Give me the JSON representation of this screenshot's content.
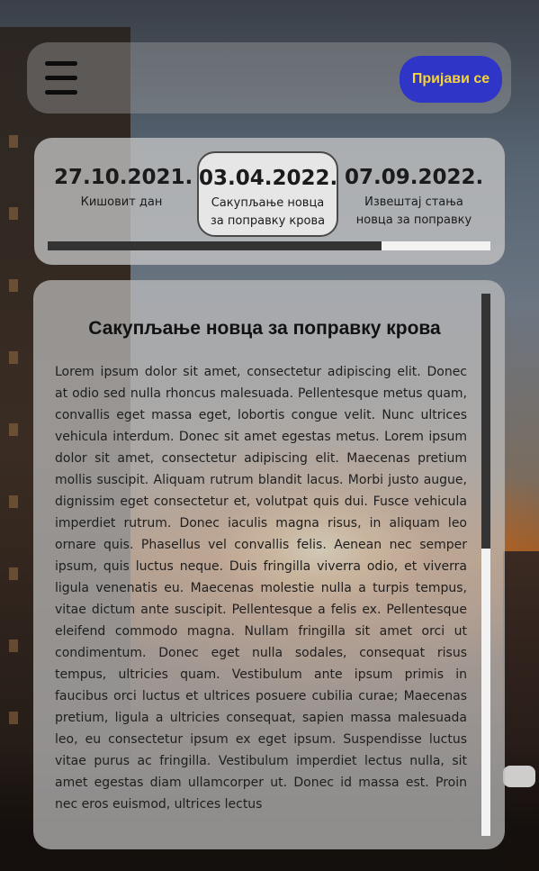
{
  "header": {
    "menu_icon": "hamburger-menu-icon",
    "login_label": "Пријави се"
  },
  "timeline": {
    "items": [
      {
        "date": "27.10.2021.",
        "label_line1": "Кишовит дан",
        "label_line2": ""
      },
      {
        "date": "03.04.2022.",
        "label_line1": "Сакупљање новца",
        "label_line2": "за поправку крова"
      },
      {
        "date": "07.09.2022.",
        "label_line1": "Извештај стања",
        "label_line2": "новца за поправку"
      }
    ],
    "active_index": 1,
    "progress": 0.755
  },
  "article": {
    "title": "Сакупљање новца за поправку крова",
    "body": "Lorem ipsum dolor sit amet, consectetur adipiscing elit. Donec at odio sed nulla rhoncus malesuada. Pellentesque metus quam, convallis eget massa eget, lobortis congue velit. Nunc ultrices vehicula interdum. Donec sit amet egestas metus. Lorem ipsum dolor sit amet, consectetur adipiscing elit. Maecenas pretium mollis suscipit. Aliquam rutrum blandit lacus. Morbi justo augue, dignissim eget consectetur et, volutpat quis dui. Fusce vehicula imperdiet rutrum. Donec iaculis magna risus, in aliquam leo ornare quis. Phasellus vel convallis felis. Aenean nec semper ipsum, quis luctus neque. Duis fringilla viverra odio, et viverra ligula venenatis eu. Maecenas molestie nulla a turpis tempus, vitae dictum ante suscipit. Pellentesque a felis ex. Pellentesque eleifend commodo magna. Nullam fringilla sit amet orci ut condimentum. Donec eget nulla sodales, consequat risus tempus, ultricies quam. Vestibulum ante ipsum primis in faucibus orci luctus et ultrices posuere cubilia curae; Maecenas pretium, ligula a ultricies consequat, sapien massa malesuada leo, eu consectetur ipsum ex eget ipsum. Suspendisse luctus vitae purus ac fringilla. Vestibulum imperdiet lectus nulla, sit amet egestas diam ullamcorper ut. Donec id massa est. Proin nec eros euismod, ultrices lectus",
    "scroll_fraction_visible": 0.47
  },
  "colors": {
    "login_bg": "#2f35c6",
    "login_text": "#f5d33b",
    "progress_fill": "#333333",
    "progress_track": "#f3f3f3"
  }
}
